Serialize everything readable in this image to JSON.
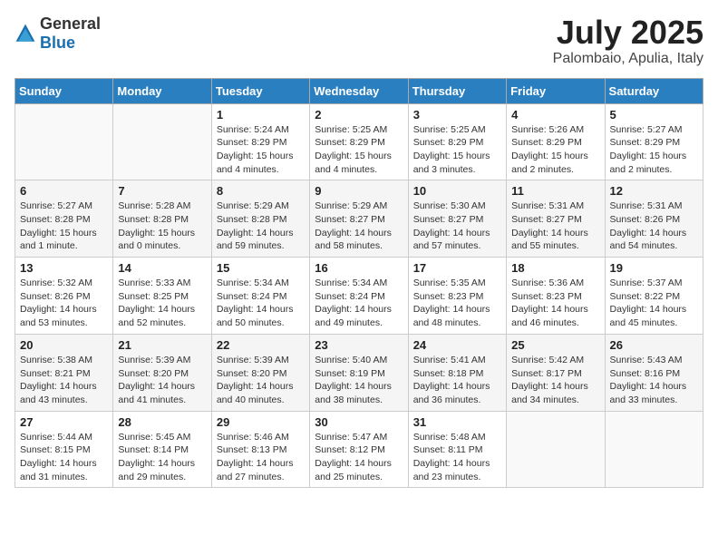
{
  "logo": {
    "general": "General",
    "blue": "Blue"
  },
  "title": {
    "month": "July 2025",
    "location": "Palombaio, Apulia, Italy"
  },
  "weekdays": [
    "Sunday",
    "Monday",
    "Tuesday",
    "Wednesday",
    "Thursday",
    "Friday",
    "Saturday"
  ],
  "weeks": [
    [
      {
        "day": "",
        "info": ""
      },
      {
        "day": "",
        "info": ""
      },
      {
        "day": "1",
        "info": "Sunrise: 5:24 AM\nSunset: 8:29 PM\nDaylight: 15 hours and 4 minutes."
      },
      {
        "day": "2",
        "info": "Sunrise: 5:25 AM\nSunset: 8:29 PM\nDaylight: 15 hours and 4 minutes."
      },
      {
        "day": "3",
        "info": "Sunrise: 5:25 AM\nSunset: 8:29 PM\nDaylight: 15 hours and 3 minutes."
      },
      {
        "day": "4",
        "info": "Sunrise: 5:26 AM\nSunset: 8:29 PM\nDaylight: 15 hours and 2 minutes."
      },
      {
        "day": "5",
        "info": "Sunrise: 5:27 AM\nSunset: 8:29 PM\nDaylight: 15 hours and 2 minutes."
      }
    ],
    [
      {
        "day": "6",
        "info": "Sunrise: 5:27 AM\nSunset: 8:28 PM\nDaylight: 15 hours and 1 minute."
      },
      {
        "day": "7",
        "info": "Sunrise: 5:28 AM\nSunset: 8:28 PM\nDaylight: 15 hours and 0 minutes."
      },
      {
        "day": "8",
        "info": "Sunrise: 5:29 AM\nSunset: 8:28 PM\nDaylight: 14 hours and 59 minutes."
      },
      {
        "day": "9",
        "info": "Sunrise: 5:29 AM\nSunset: 8:27 PM\nDaylight: 14 hours and 58 minutes."
      },
      {
        "day": "10",
        "info": "Sunrise: 5:30 AM\nSunset: 8:27 PM\nDaylight: 14 hours and 57 minutes."
      },
      {
        "day": "11",
        "info": "Sunrise: 5:31 AM\nSunset: 8:27 PM\nDaylight: 14 hours and 55 minutes."
      },
      {
        "day": "12",
        "info": "Sunrise: 5:31 AM\nSunset: 8:26 PM\nDaylight: 14 hours and 54 minutes."
      }
    ],
    [
      {
        "day": "13",
        "info": "Sunrise: 5:32 AM\nSunset: 8:26 PM\nDaylight: 14 hours and 53 minutes."
      },
      {
        "day": "14",
        "info": "Sunrise: 5:33 AM\nSunset: 8:25 PM\nDaylight: 14 hours and 52 minutes."
      },
      {
        "day": "15",
        "info": "Sunrise: 5:34 AM\nSunset: 8:24 PM\nDaylight: 14 hours and 50 minutes."
      },
      {
        "day": "16",
        "info": "Sunrise: 5:34 AM\nSunset: 8:24 PM\nDaylight: 14 hours and 49 minutes."
      },
      {
        "day": "17",
        "info": "Sunrise: 5:35 AM\nSunset: 8:23 PM\nDaylight: 14 hours and 48 minutes."
      },
      {
        "day": "18",
        "info": "Sunrise: 5:36 AM\nSunset: 8:23 PM\nDaylight: 14 hours and 46 minutes."
      },
      {
        "day": "19",
        "info": "Sunrise: 5:37 AM\nSunset: 8:22 PM\nDaylight: 14 hours and 45 minutes."
      }
    ],
    [
      {
        "day": "20",
        "info": "Sunrise: 5:38 AM\nSunset: 8:21 PM\nDaylight: 14 hours and 43 minutes."
      },
      {
        "day": "21",
        "info": "Sunrise: 5:39 AM\nSunset: 8:20 PM\nDaylight: 14 hours and 41 minutes."
      },
      {
        "day": "22",
        "info": "Sunrise: 5:39 AM\nSunset: 8:20 PM\nDaylight: 14 hours and 40 minutes."
      },
      {
        "day": "23",
        "info": "Sunrise: 5:40 AM\nSunset: 8:19 PM\nDaylight: 14 hours and 38 minutes."
      },
      {
        "day": "24",
        "info": "Sunrise: 5:41 AM\nSunset: 8:18 PM\nDaylight: 14 hours and 36 minutes."
      },
      {
        "day": "25",
        "info": "Sunrise: 5:42 AM\nSunset: 8:17 PM\nDaylight: 14 hours and 34 minutes."
      },
      {
        "day": "26",
        "info": "Sunrise: 5:43 AM\nSunset: 8:16 PM\nDaylight: 14 hours and 33 minutes."
      }
    ],
    [
      {
        "day": "27",
        "info": "Sunrise: 5:44 AM\nSunset: 8:15 PM\nDaylight: 14 hours and 31 minutes."
      },
      {
        "day": "28",
        "info": "Sunrise: 5:45 AM\nSunset: 8:14 PM\nDaylight: 14 hours and 29 minutes."
      },
      {
        "day": "29",
        "info": "Sunrise: 5:46 AM\nSunset: 8:13 PM\nDaylight: 14 hours and 27 minutes."
      },
      {
        "day": "30",
        "info": "Sunrise: 5:47 AM\nSunset: 8:12 PM\nDaylight: 14 hours and 25 minutes."
      },
      {
        "day": "31",
        "info": "Sunrise: 5:48 AM\nSunset: 8:11 PM\nDaylight: 14 hours and 23 minutes."
      },
      {
        "day": "",
        "info": ""
      },
      {
        "day": "",
        "info": ""
      }
    ]
  ]
}
